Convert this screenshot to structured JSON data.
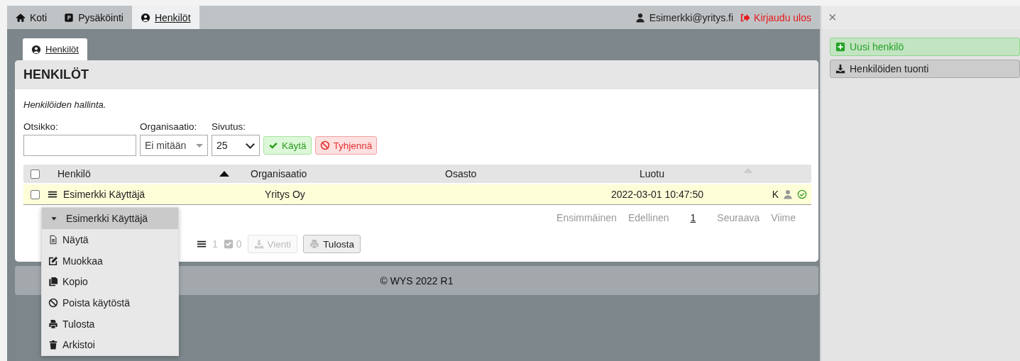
{
  "nav": {
    "tabs": [
      {
        "label": "Koti",
        "selected": false
      },
      {
        "label": "Pysäköinti",
        "selected": false
      },
      {
        "label": "Henkilöt",
        "selected": true
      }
    ],
    "user": "Esimerkki@yritys.fi",
    "logout": "Kirjaudu ulos"
  },
  "page_tabs": [
    {
      "label": "Henkilöt",
      "selected": true
    }
  ],
  "panel": {
    "title": "HENKILÖT",
    "description": "Henkilöiden hallinta.",
    "filters": [
      {
        "kind": "text",
        "label": "Otsikko:"
      },
      {
        "kind": "dropdown",
        "label": "Organisaatio:",
        "value": "Ei mitään"
      },
      {
        "kind": "select",
        "label": "Sivutus:",
        "value": "25"
      }
    ],
    "apply": "Käytä",
    "clear": "Tyhjennä",
    "table": {
      "select_all_checked": false,
      "columns": [
        {
          "label": "Henkilö",
          "sorted": true
        },
        {
          "label": "Organisaatio"
        },
        {
          "label": "Osasto"
        },
        {
          "label": "Luotu",
          "sorted": false
        }
      ],
      "rows": [
        {
          "checked": false,
          "highlighted": true,
          "cells": [
            "Esimerkki Käyttäjä",
            "Yritys Oy",
            "",
            "2022-03-01 10:47:50"
          ],
          "badge": "K",
          "active": true
        }
      ]
    },
    "pagination": [
      {
        "label": "Ensimmäinen",
        "selected": false
      },
      {
        "label": "Edellinen",
        "selected": false
      },
      {
        "label": "1",
        "selected": true
      },
      {
        "label": "Seuraava",
        "selected": false
      },
      {
        "label": "Viime",
        "selected": false
      }
    ],
    "toolbar": {
      "count": "1",
      "checked_count": "0",
      "buttons": [
        {
          "label": "Vienti",
          "disabled": true
        },
        {
          "label": "Tulosta",
          "disabled": false
        }
      ]
    }
  },
  "footer": "© WYS 2022 R1",
  "context_menu": {
    "title": "Esimerkki Käyttäjä",
    "items": [
      {
        "label": "Näytä"
      },
      {
        "label": "Muokkaa"
      },
      {
        "label": "Kopio"
      },
      {
        "label": "Poista käytöstä"
      },
      {
        "label": "Tulosta"
      },
      {
        "label": "Arkistoi"
      }
    ]
  },
  "side_panel": {
    "close": "×",
    "buttons": [
      {
        "label": "Uusi henkilö",
        "kind": "success"
      },
      {
        "label": "Henkilöiden tuonti",
        "kind": "default"
      }
    ]
  }
}
